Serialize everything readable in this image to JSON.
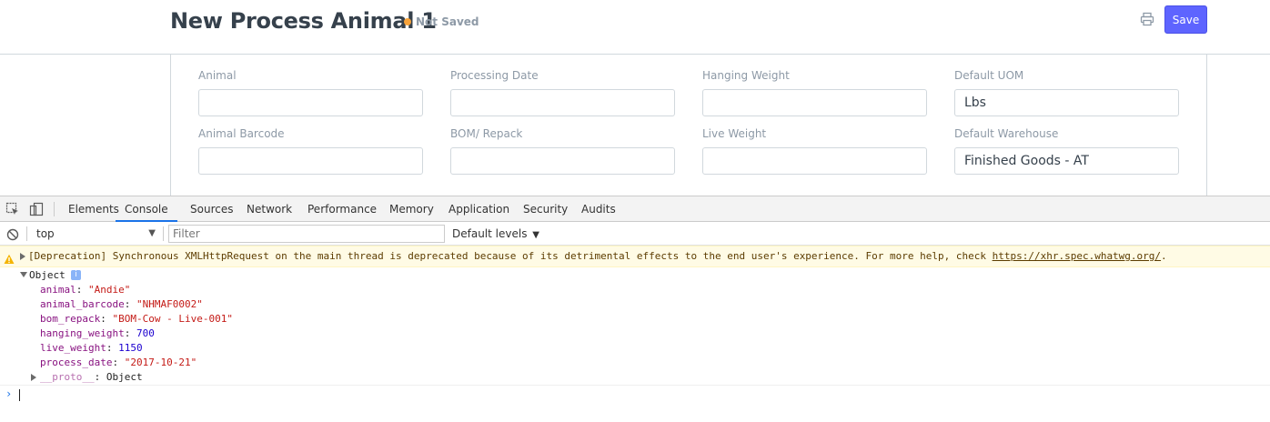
{
  "header": {
    "title": "New Process Animal 1",
    "status": "Not Saved",
    "status_color": "#f8a33a",
    "print_icon": "print-icon",
    "save_label": "Save",
    "accent": "#5e64ff"
  },
  "form": {
    "fields": [
      {
        "label": "Animal",
        "value": ""
      },
      {
        "label": "Processing Date",
        "value": ""
      },
      {
        "label": "Hanging Weight",
        "value": ""
      },
      {
        "label": "Default UOM",
        "value": "Lbs"
      },
      {
        "label": "Animal Barcode",
        "value": ""
      },
      {
        "label": "BOM/ Repack",
        "value": ""
      },
      {
        "label": "Live Weight",
        "value": ""
      },
      {
        "label": "Default Warehouse",
        "value": "Finished Goods - AT"
      }
    ]
  },
  "devtools": {
    "tabs": [
      "Elements",
      "Console",
      "Sources",
      "Network",
      "Performance",
      "Memory",
      "Application",
      "Security",
      "Audits"
    ],
    "active_tab": "Console",
    "context": "top",
    "filter_placeholder": "Filter",
    "levels": "Default levels",
    "warning": {
      "text": "[Deprecation] Synchronous XMLHttpRequest on the main thread is deprecated because of its detrimental effects to the end user's experience. For more help, check ",
      "link": "https://xhr.spec.whatwg.org/",
      "suffix": "."
    },
    "object": {
      "label": "Object",
      "info": "i",
      "props": [
        {
          "key": "animal",
          "value": "\"Andie\"",
          "type": "str"
        },
        {
          "key": "animal_barcode",
          "value": "\"NHMAF0002\"",
          "type": "str"
        },
        {
          "key": "bom_repack",
          "value": "\"BOM-Cow - Live-001\"",
          "type": "str"
        },
        {
          "key": "hanging_weight",
          "value": "700",
          "type": "num"
        },
        {
          "key": "live_weight",
          "value": "1150",
          "type": "num"
        },
        {
          "key": "process_date",
          "value": "\"2017-10-21\"",
          "type": "str"
        }
      ],
      "proto_key": "__proto__",
      "proto_value": "Object"
    },
    "prompt": "›"
  }
}
